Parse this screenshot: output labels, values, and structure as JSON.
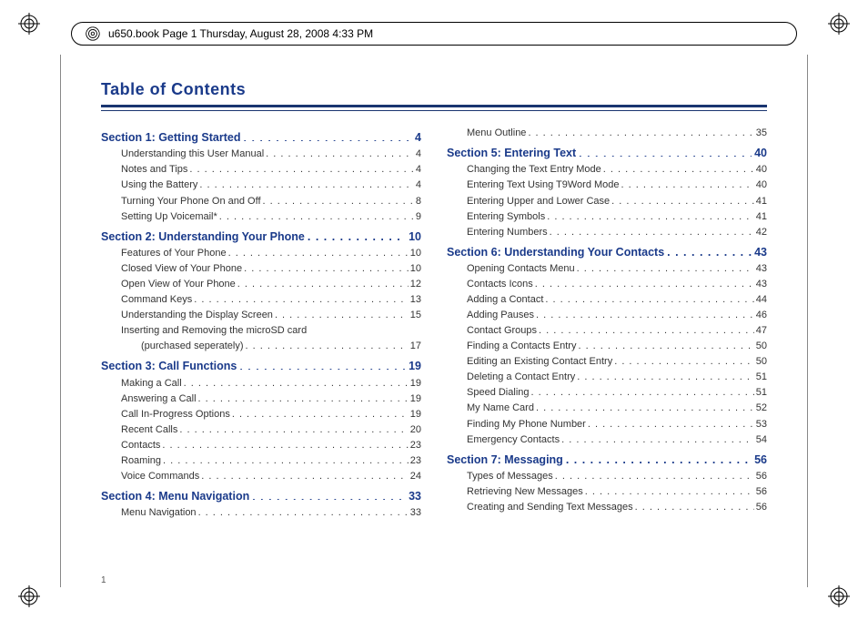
{
  "header": "u650.book  Page 1  Thursday, August 28, 2008  4:33 PM",
  "title": "Table of Contents",
  "page_number": "1",
  "columns": [
    [
      {
        "type": "section",
        "label": "Section 1:  Getting Started",
        "page": "4"
      },
      {
        "type": "entry",
        "label": "Understanding this User Manual",
        "page": "4"
      },
      {
        "type": "entry",
        "label": "Notes and Tips",
        "page": "4"
      },
      {
        "type": "entry",
        "label": "Using the Battery",
        "page": "4"
      },
      {
        "type": "entry",
        "label": "Turning Your Phone On and Off",
        "page": "8"
      },
      {
        "type": "entry",
        "label": "Setting Up Voicemail*",
        "page": "9"
      },
      {
        "type": "section",
        "label": "Section 2:  Understanding Your Phone",
        "page": "10"
      },
      {
        "type": "entry",
        "label": "Features of Your Phone",
        "page": "10"
      },
      {
        "type": "entry",
        "label": "Closed View of Your Phone",
        "page": "10"
      },
      {
        "type": "entry",
        "label": "Open View of Your Phone",
        "page": "12"
      },
      {
        "type": "entry",
        "label": "Command Keys",
        "page": "13"
      },
      {
        "type": "entry",
        "label": "Understanding the Display Screen",
        "page": "15"
      },
      {
        "type": "entry",
        "label": "Inserting and Removing the microSD card",
        "page": ""
      },
      {
        "type": "entry",
        "indent": 2,
        "label": "(purchased seperately)",
        "page": "17"
      },
      {
        "type": "section",
        "label": "Section 3:   Call Functions",
        "page": "19"
      },
      {
        "type": "entry",
        "label": "Making a Call",
        "page": "19"
      },
      {
        "type": "entry",
        "label": "Answering a Call",
        "page": "19"
      },
      {
        "type": "entry",
        "label": "Call In-Progress Options",
        "page": "19"
      },
      {
        "type": "entry",
        "label": "Recent Calls",
        "page": "20"
      },
      {
        "type": "entry",
        "label": "Contacts",
        "page": "23"
      },
      {
        "type": "entry",
        "label": "Roaming",
        "page": "23"
      },
      {
        "type": "entry",
        "label": "Voice Commands",
        "page": "24"
      },
      {
        "type": "section",
        "label": "Section 4:  Menu Navigation",
        "page": "33"
      },
      {
        "type": "entry",
        "label": "Menu Navigation",
        "page": "33"
      }
    ],
    [
      {
        "type": "entry",
        "label": "Menu Outline",
        "page": "35"
      },
      {
        "type": "section",
        "label": "Section 5:  Entering Text",
        "page": "40"
      },
      {
        "type": "entry",
        "label": "Changing the Text Entry Mode",
        "page": "40"
      },
      {
        "type": "entry",
        "label": "Entering Text Using T9Word Mode",
        "page": "40"
      },
      {
        "type": "entry",
        "label": "Entering Upper and Lower Case",
        "page": "41"
      },
      {
        "type": "entry",
        "label": "Entering Symbols",
        "page": "41"
      },
      {
        "type": "entry",
        "label": "Entering Numbers",
        "page": "42"
      },
      {
        "type": "section",
        "label": "Section 6:  Understanding Your Contacts",
        "page": "43"
      },
      {
        "type": "entry",
        "label": "Opening Contacts Menu",
        "page": "43"
      },
      {
        "type": "entry",
        "label": "Contacts Icons",
        "page": "43"
      },
      {
        "type": "entry",
        "label": "Adding a Contact",
        "page": "44"
      },
      {
        "type": "entry",
        "label": "Adding Pauses",
        "page": "46"
      },
      {
        "type": "entry",
        "label": "Contact Groups",
        "page": "47"
      },
      {
        "type": "entry",
        "label": "Finding a Contacts Entry",
        "page": "50"
      },
      {
        "type": "entry",
        "label": "Editing an Existing Contact Entry",
        "page": "50"
      },
      {
        "type": "entry",
        "label": "Deleting a Contact Entry",
        "page": "51"
      },
      {
        "type": "entry",
        "label": "Speed Dialing",
        "page": "51"
      },
      {
        "type": "entry",
        "label": "My Name Card",
        "page": "52"
      },
      {
        "type": "entry",
        "label": "Finding My Phone Number",
        "page": "53"
      },
      {
        "type": "entry",
        "label": "Emergency Contacts",
        "page": "54"
      },
      {
        "type": "section",
        "label": "Section 7:   Messaging",
        "page": "56"
      },
      {
        "type": "entry",
        "label": "Types of Messages",
        "page": "56"
      },
      {
        "type": "entry",
        "label": "Retrieving New Messages",
        "page": "56"
      },
      {
        "type": "entry",
        "label": "Creating and Sending Text Messages",
        "page": "56"
      }
    ]
  ]
}
